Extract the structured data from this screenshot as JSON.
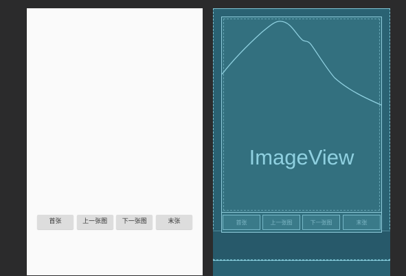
{
  "design": {
    "buttons": [
      {
        "label": "首张"
      },
      {
        "label": "上一张图"
      },
      {
        "label": "下一张图"
      },
      {
        "label": "末张"
      }
    ]
  },
  "blueprint": {
    "component_label": "ImageView",
    "buttons": [
      {
        "label": "首张"
      },
      {
        "label": "上一张图"
      },
      {
        "label": "下一张图"
      },
      {
        "label": "末张"
      }
    ]
  },
  "colors": {
    "canvas_background": "#2b2b2c",
    "design_background": "#fafafa",
    "blueprint_background": "#2a6273",
    "blueprint_line": "#7fc3d3"
  }
}
